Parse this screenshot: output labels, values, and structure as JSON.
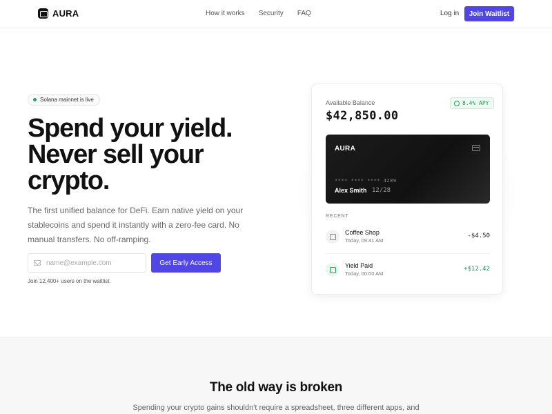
{
  "header": {
    "brand": "AURA",
    "nav": [
      "How it works",
      "Security",
      "FAQ"
    ],
    "login": "Log in",
    "join": "Join Waitlist"
  },
  "hero": {
    "badge": "Solana mainnet is live",
    "title_lines": [
      "Spend your yield.",
      "Never sell your",
      "crypto."
    ],
    "subtitle": "The first unified balance for DeFi. Earn native yield on your stablecoins and spend it instantly with a zero-fee card. No manual transfers. No off-ramping.",
    "email_placeholder": "name@example.com",
    "cta": "Get Early Access",
    "waitlist_note": "Join 12,400+ users on the waitlist."
  },
  "wallet": {
    "balance_label": "Available Balance",
    "balance": "$42,850.00",
    "apy": "8.4% APY",
    "card": {
      "brand": "AURA",
      "number": "**** **** **** 4289",
      "holder": "Alex Smith",
      "expiry": "12/28"
    },
    "recent_label": "RECENT",
    "transactions": [
      {
        "name": "Coffee Shop",
        "time": "Today, 09:41 AM",
        "amount": "-$4.50",
        "icon": "receipt-icon"
      },
      {
        "name": "Yield Paid",
        "time": "Today, 00:00 AM",
        "amount": "+$12.42",
        "icon": "yield-icon"
      }
    ]
  },
  "section2": {
    "title": "The old way is broken",
    "subtitle": "Spending your crypto gains shouldn't require a spreadsheet, three different apps, and"
  },
  "colors": {
    "accent": "#4f46e5",
    "positive": "#1e9b5a",
    "card_bg": "#141414"
  }
}
